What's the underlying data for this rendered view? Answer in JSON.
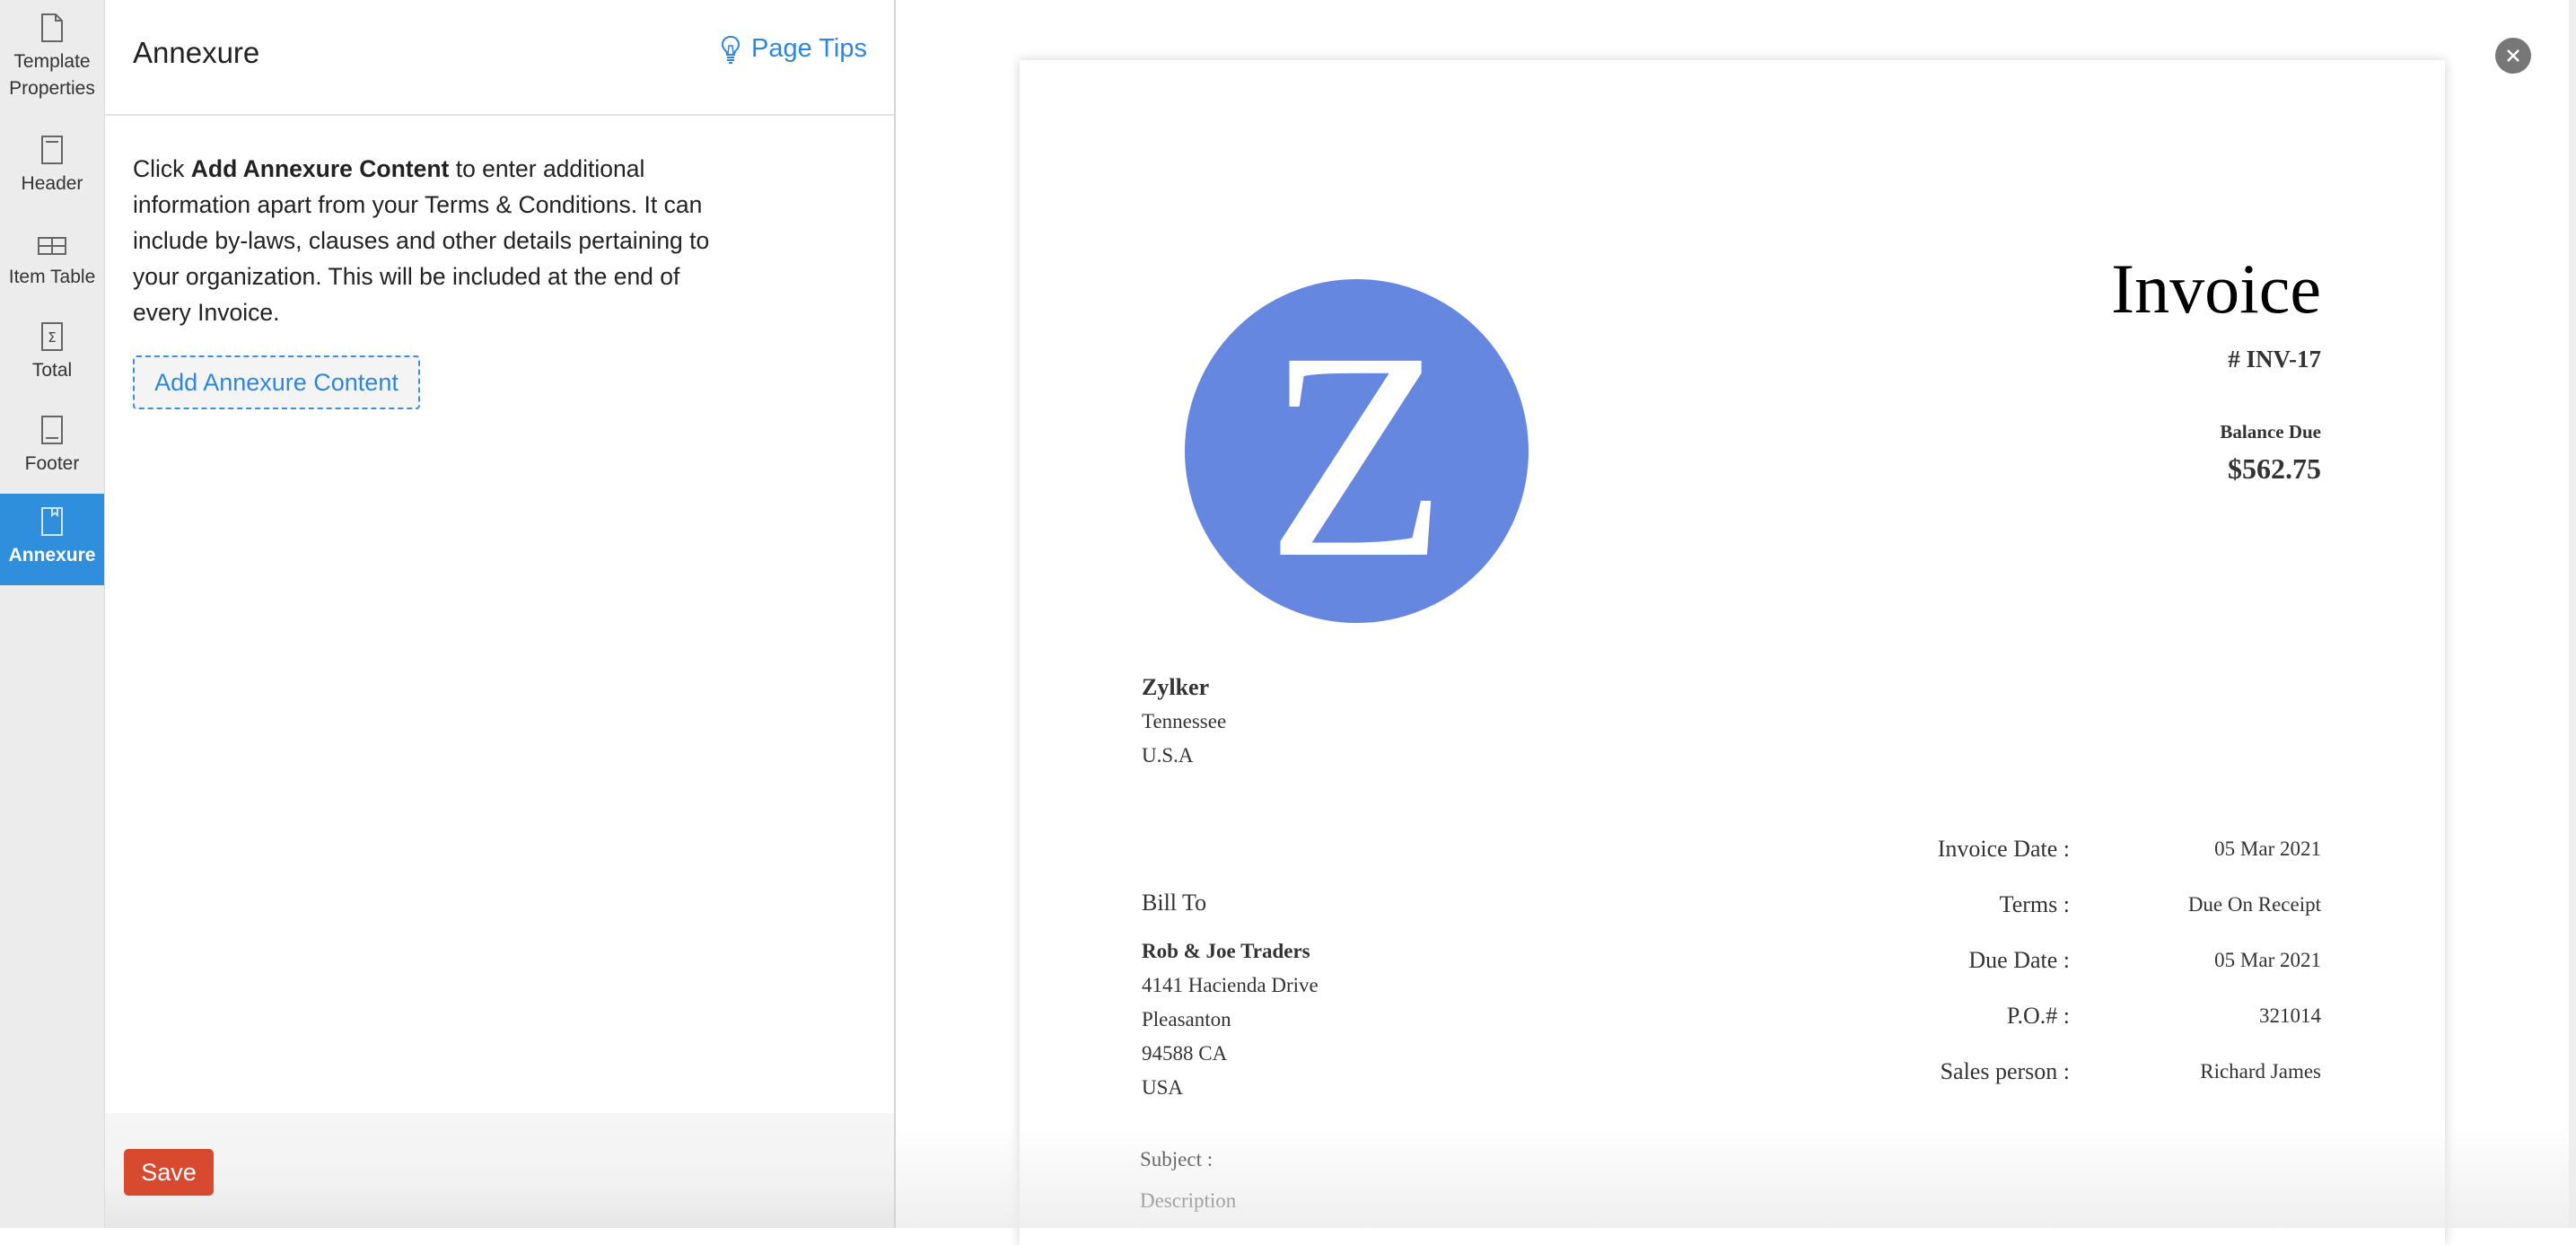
{
  "sidebar": {
    "items": [
      {
        "label_line1": "Template",
        "label_line2": "Properties",
        "icon": "page-icon",
        "active": false
      },
      {
        "label": "Header",
        "icon": "header-icon",
        "active": false
      },
      {
        "label": "Item Table",
        "icon": "table-icon",
        "active": false
      },
      {
        "label": "Total",
        "icon": "sigma-icon",
        "active": false
      },
      {
        "label": "Footer",
        "icon": "footer-icon",
        "active": false
      },
      {
        "label": "Annexure",
        "icon": "annexure-icon",
        "active": true
      }
    ],
    "active_color": "#2f8fdd"
  },
  "panel": {
    "title": "Annexure",
    "page_tips": "Page Tips",
    "description": {
      "prefix": "Click ",
      "bold": "Add Annexure Content",
      "suffix": " to enter additional information apart from your Terms & Conditions. It can include by-laws, clauses and other details pertaining to your organization. This will be included at the end of every Invoice."
    },
    "add_button": "Add Annexure Content",
    "save_button": "Save",
    "save_color": "#d84a30",
    "link_color": "#2e86de"
  },
  "preview": {
    "logo_letter": "Z",
    "logo_color": "#6587e0",
    "title": "Invoice",
    "number": "# INV-17",
    "balance_label": "Balance Due",
    "balance_amount": "$562.75",
    "org": {
      "name": "Zylker",
      "lines": [
        "Tennessee",
        "U.S.A"
      ]
    },
    "bill_to_label": "Bill To",
    "bill_to": {
      "name": "Rob & Joe Traders",
      "lines": [
        "4141 Hacienda Drive",
        "Pleasanton",
        "94588 CA",
        "USA"
      ]
    },
    "meta": [
      {
        "label": "Invoice Date :",
        "value": "05 Mar 2021"
      },
      {
        "label": "Terms :",
        "value": "Due On Receipt"
      },
      {
        "label": "Due Date :",
        "value": "05 Mar 2021"
      },
      {
        "label": "P.O.# :",
        "value": "321014"
      },
      {
        "label": "Sales person :",
        "value": "Richard James"
      }
    ],
    "subject_label": "Subject :",
    "description_label": "Description"
  }
}
